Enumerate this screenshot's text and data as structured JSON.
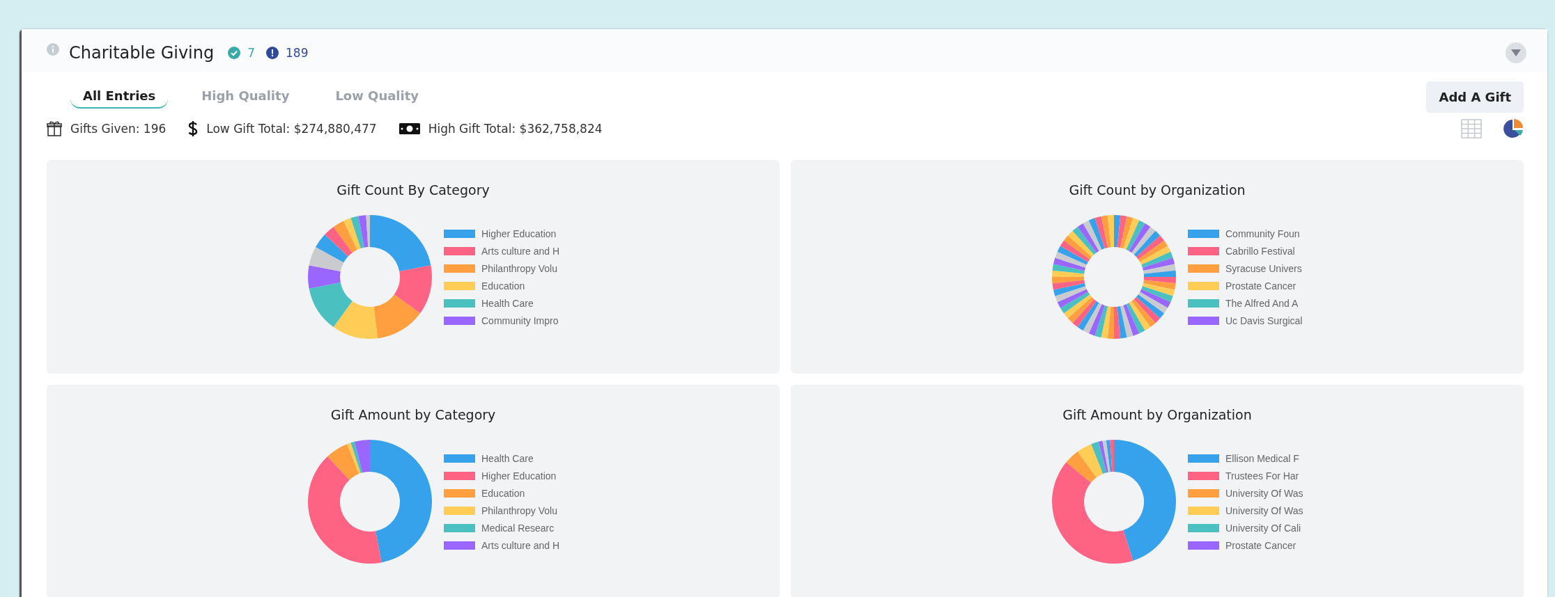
{
  "header": {
    "title": "Charitable Giving",
    "verified_count": "7",
    "alert_count": "189"
  },
  "tabs": [
    {
      "label": "All Entries",
      "selected": true
    },
    {
      "label": "High Quality",
      "selected": false
    },
    {
      "label": "Low Quality",
      "selected": false
    }
  ],
  "add_button": "Add A Gift",
  "stats": [
    {
      "kind": "gift",
      "text": "Gifts Given: 196"
    },
    {
      "kind": "dollar",
      "text": "Low Gift Total: $274,880,477"
    },
    {
      "kind": "cash",
      "text": "High Gift Total: $362,758,824"
    }
  ],
  "charts": [
    {
      "title": "Gift Count By Category",
      "legend": [
        {
          "label": "Higher Education",
          "color": "#36a2eb"
        },
        {
          "label": "Arts culture and H",
          "color": "#ff6384"
        },
        {
          "label": "Philanthropy Volu",
          "color": "#ff9f40"
        },
        {
          "label": "Education",
          "color": "#ffcd56"
        },
        {
          "label": "Health Care",
          "color": "#4bc0c0"
        },
        {
          "label": "Community Impro",
          "color": "#9966ff"
        }
      ]
    },
    {
      "title": "Gift Count by Organization",
      "legend": [
        {
          "label": "Community Foun",
          "color": "#36a2eb"
        },
        {
          "label": "Cabrillo Festival",
          "color": "#ff6384"
        },
        {
          "label": "Syracuse Univers",
          "color": "#ff9f40"
        },
        {
          "label": "Prostate Cancer",
          "color": "#ffcd56"
        },
        {
          "label": "The Alfred And A",
          "color": "#4bc0c0"
        },
        {
          "label": "Uc Davis Surgical",
          "color": "#9966ff"
        }
      ]
    },
    {
      "title": "Gift Amount by Category",
      "legend": [
        {
          "label": "Health Care",
          "color": "#36a2eb"
        },
        {
          "label": "Higher Education",
          "color": "#ff6384"
        },
        {
          "label": "Education",
          "color": "#ff9f40"
        },
        {
          "label": "Philanthropy Volu",
          "color": "#ffcd56"
        },
        {
          "label": "Medical Researc",
          "color": "#4bc0c0"
        },
        {
          "label": "Arts culture and H",
          "color": "#9966ff"
        }
      ]
    },
    {
      "title": "Gift Amount by Organization",
      "legend": [
        {
          "label": "Ellison Medical F",
          "color": "#36a2eb"
        },
        {
          "label": "Trustees For Har",
          "color": "#ff6384"
        },
        {
          "label": "University Of Was",
          "color": "#ff9f40"
        },
        {
          "label": "University Of Was",
          "color": "#ffcd56"
        },
        {
          "label": "University Of Cali",
          "color": "#4bc0c0"
        },
        {
          "label": "Prostate Cancer",
          "color": "#9966ff"
        }
      ]
    }
  ]
}
